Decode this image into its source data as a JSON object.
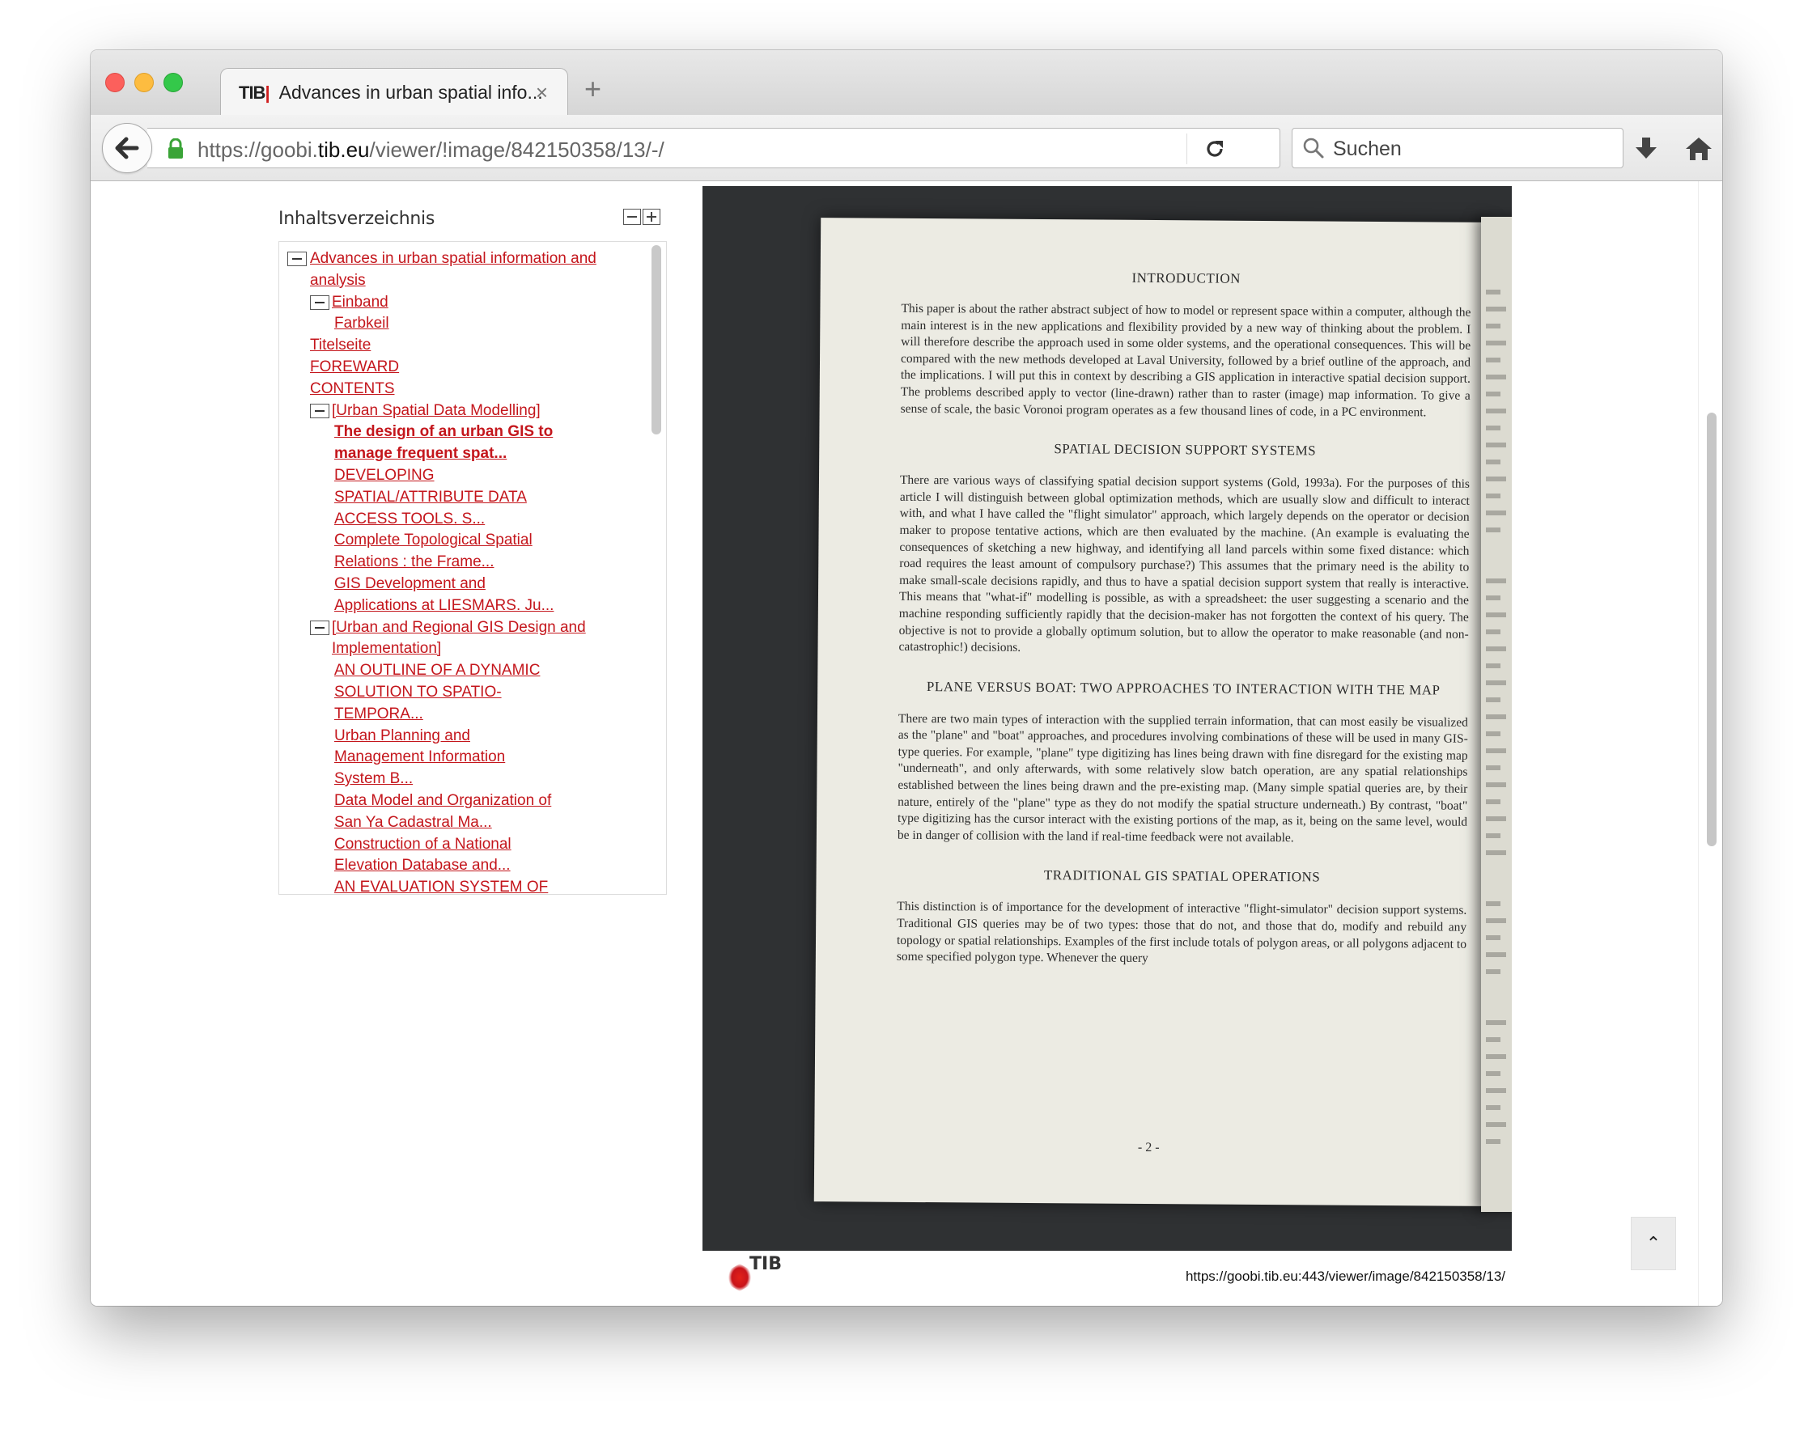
{
  "browser": {
    "tab": {
      "favicon_prefix": "TIB",
      "favicon_bar": "|",
      "title": "Advances in urban spatial info...",
      "close_glyph": "×"
    },
    "new_tab_glyph": "+",
    "url": {
      "prefix": "https://goobi.",
      "domain": "tib.eu",
      "path": "/viewer/!image/842150358/13/-/"
    },
    "search_placeholder": "Suchen"
  },
  "toc": {
    "heading": "Inhaltsverzeichnis",
    "items": [
      {
        "label": "Advances in urban spatial information and analysis",
        "level": 0,
        "toggle": true,
        "active": false
      },
      {
        "label": "Einband",
        "level": 1,
        "toggle": true,
        "active": false
      },
      {
        "label": "Farbkeil",
        "level": 2,
        "toggle": false,
        "active": false
      },
      {
        "label": "Titelseite",
        "level": 0,
        "toggle": false,
        "active": false
      },
      {
        "label": "FOREWARD",
        "level": 0,
        "toggle": false,
        "active": false
      },
      {
        "label": "CONTENTS",
        "level": 0,
        "toggle": false,
        "active": false
      },
      {
        "label": "[Urban Spatial Data Modelling]",
        "level": 1,
        "toggle": true,
        "active": false
      },
      {
        "label": "The design of an urban GIS to manage frequent spat...",
        "level": 2,
        "toggle": false,
        "active": true
      },
      {
        "label": "DEVELOPING SPATIAL/ATTRIBUTE DATA ACCESS TOOLS. S...",
        "level": 2,
        "toggle": false,
        "active": false
      },
      {
        "label": "Complete Topological Spatial Relations : the Frame...",
        "level": 2,
        "toggle": false,
        "active": false
      },
      {
        "label": "GIS Development and Applications at LIESMARS. Ju...",
        "level": 2,
        "toggle": false,
        "active": false
      },
      {
        "label": "[Urban and Regional GIS Design and Implementation]",
        "level": 1,
        "toggle": true,
        "active": false
      },
      {
        "label": "AN OUTLINE OF A DYNAMIC SOLUTION TO SPATIO-TEMPORA...",
        "level": 2,
        "toggle": false,
        "active": false
      },
      {
        "label": "Urban Planning and Management Information System B...",
        "level": 2,
        "toggle": false,
        "active": false
      },
      {
        "label": "Data Model and Organization of San Ya Cadastral Ma...",
        "level": 2,
        "toggle": false,
        "active": false
      },
      {
        "label": "Construction of a National Elevation Database and...",
        "level": 2,
        "toggle": false,
        "active": false
      },
      {
        "label": "AN EVALUATION SYSTEM OF INVESTMENT ENVIRONMENT",
        "level": 2,
        "toggle": false,
        "active": false
      }
    ]
  },
  "document": {
    "sections": [
      {
        "heading": "INTRODUCTION",
        "body": "This paper is about the rather abstract subject of how to model or represent space within a computer, although the main interest is in the new applications and flexibility provided by a new way of thinking about the problem. I will therefore describe the approach used in some older systems, and the operational consequences. This will be compared with the new methods developed at Laval University, followed by a brief outline of the approach, and the implications. I will put this in context by describing a GIS application in interactive spatial decision support. The problems described apply to vector (line-drawn) rather than to raster (image) map information. To give a sense of scale, the basic Voronoi program operates as a few thousand lines of code, in a PC environment."
      },
      {
        "heading": "SPATIAL DECISION SUPPORT SYSTEMS",
        "body": "There are various ways of classifying spatial decision support systems (Gold, 1993a). For the purposes of this article I will distinguish between global optimization methods, which are usually slow and difficult to interact with, and what I have called the \"flight simulator\" approach, which largely depends on the operator or decision maker to propose tentative actions, which are then evaluated by the machine. (An example is evaluating the consequences of sketching a new highway, and identifying all land parcels within some fixed distance: which road requires the least amount of compulsory purchase?) This assumes that the primary need is the ability to make small-scale decisions rapidly, and thus to have a spatial decision support system that really is interactive. This means that \"what-if\" modelling is possible, as with a spreadsheet: the user suggesting a scenario and the machine responding sufficiently rapidly that the decision-maker has not forgotten the context of his query. The objective is not to provide a globally optimum solution, but to allow the operator to make reasonable (and non-catastrophic!) decisions."
      },
      {
        "heading": "PLANE VERSUS BOAT: TWO APPROACHES TO INTERACTION WITH THE MAP",
        "body": "There are two main types of interaction with the supplied terrain information, that can most easily be visualized as the \"plane\" and \"boat\" approaches, and procedures involving combinations of these will be used in many GIS-type queries. For example, \"plane\" type digitizing has lines being drawn with fine disregard for the existing map \"underneath\", and only afterwards, with some relatively slow batch operation, are any spatial relationships established between the lines being drawn and the pre-existing map. (Many simple spatial queries are, by their nature, entirely of the \"plane\" type as they do not modify the spatial structure underneath.) By contrast, \"boat\" type digitizing has the cursor interact with the existing portions of the map, as it, being on the same level, would be in danger of collision with the land if real-time feedback were not available."
      },
      {
        "heading": "TRADITIONAL GIS SPATIAL OPERATIONS",
        "body": "This distinction is of importance for the development of interactive \"flight-simulator\" decision support systems. Traditional GIS queries may be of two types: those that do not, and those that do, modify and rebuild any topology or spatial relationships. Examples of the first include totals of polygon areas, or all polygons adjacent to some specified polygon type. Whenever the query"
      }
    ],
    "page_number": "- 2 -"
  },
  "viewer_footer": {
    "logo_text": "TIB",
    "url": "https://goobi.tib.eu:443/viewer/image/842150358/13/"
  },
  "scroll_top_glyph": "⌃",
  "colors": {
    "link": "#c4161c",
    "viewer_bg": "#2f3133",
    "paper": "#ecebe3"
  }
}
